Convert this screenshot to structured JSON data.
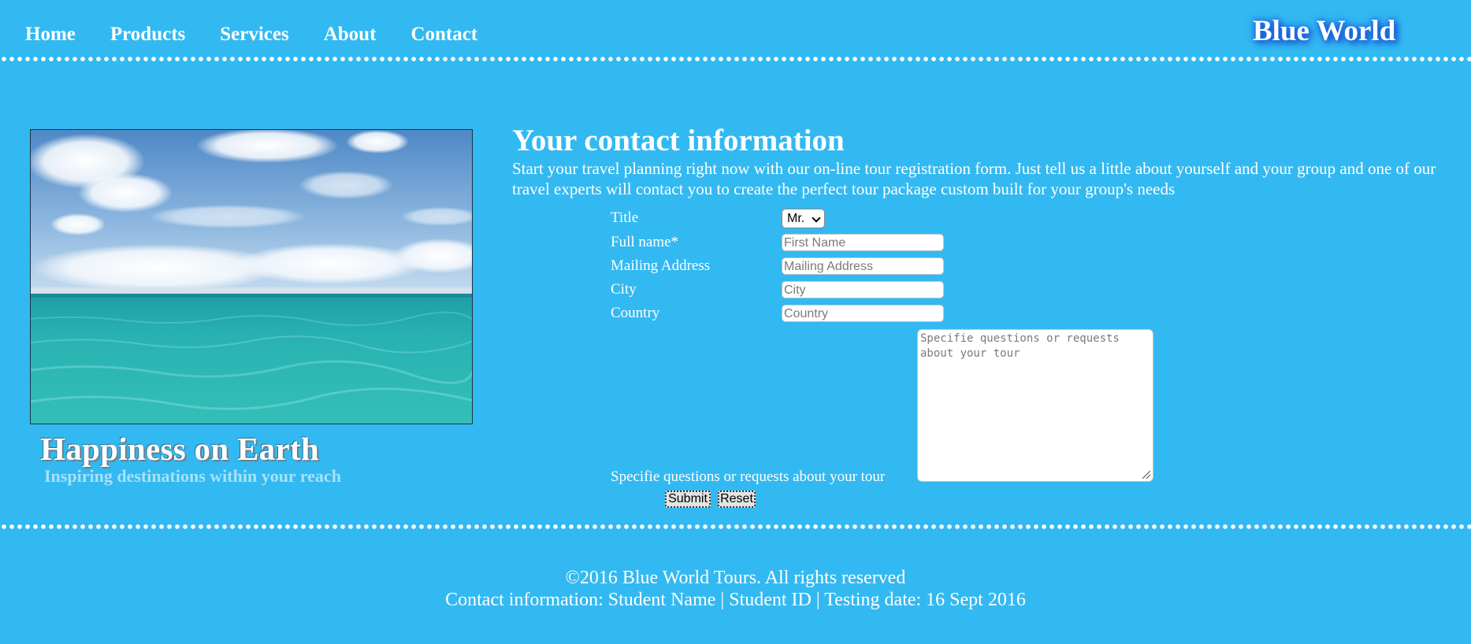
{
  "nav": {
    "items": [
      {
        "label": "Home"
      },
      {
        "label": "Products"
      },
      {
        "label": "Services"
      },
      {
        "label": "About"
      },
      {
        "label": "Contact"
      }
    ]
  },
  "brand": {
    "title": "Blue World"
  },
  "hero": {
    "title": "Happiness on Earth",
    "subtitle": "Inspiring destinations within your reach"
  },
  "content": {
    "title": "Your contact information",
    "intro": "Start your travel planning right now with our on-line tour registration form. Just tell us a little about yourself and your group and one of our travel experts will contact you to create the perfect tour package custom built for your group's needs"
  },
  "form": {
    "title_label": "Title",
    "title_value": "Mr.",
    "fullname_label": "Full name*",
    "fullname_placeholder": "First Name",
    "address_label": "Mailing Address",
    "address_placeholder": "Mailing Address",
    "city_label": "City",
    "city_placeholder": "City",
    "country_label": "Country",
    "country_placeholder": "Country",
    "questions_label": "Specifie questions or requests about your tour",
    "questions_placeholder": "Specifie questions or requests about your tour",
    "submit_label": "Submit",
    "reset_label": "Reset"
  },
  "footer": {
    "copyright": "©2016 Blue World Tours. All rights reserved",
    "contact": "Contact information: Student Name | Student ID | Testing date: 16 Sept 2016"
  },
  "colors": {
    "background": "#33b9f1",
    "text": "#ffffff",
    "subtitle": "#a6e2fb",
    "brand_glow": "#1a5fe0"
  }
}
